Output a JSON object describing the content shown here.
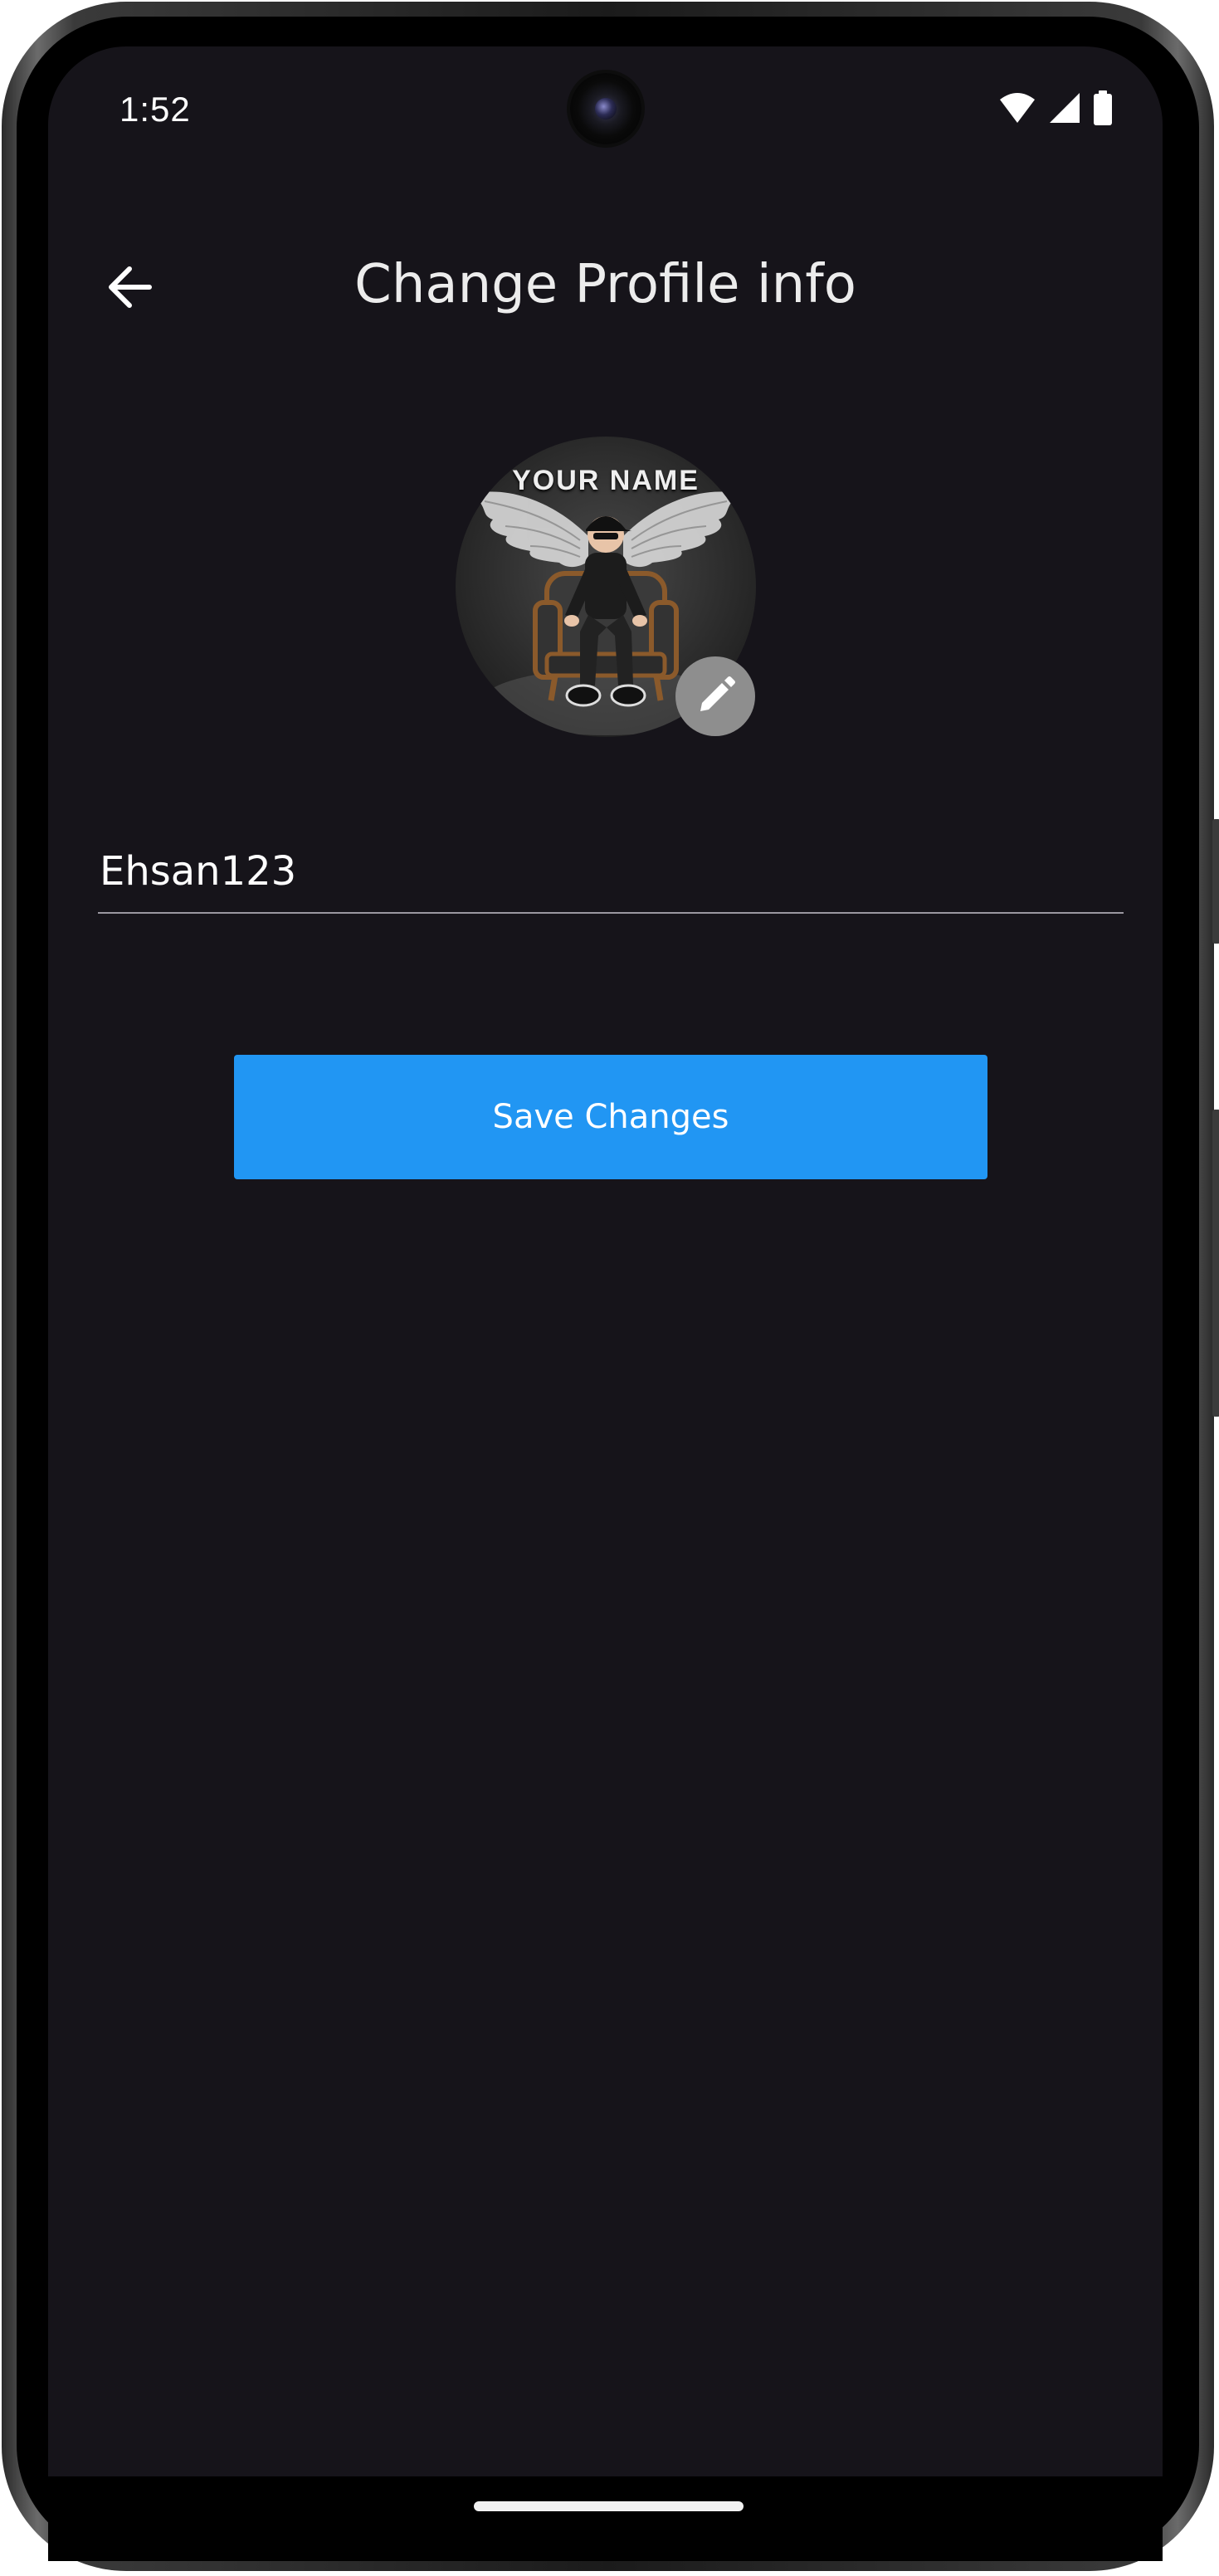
{
  "status_bar": {
    "time": "1:52",
    "icons": [
      "wifi-icon",
      "cellular-signal-icon",
      "battery-icon"
    ]
  },
  "app_bar": {
    "back_icon": "arrow-left-icon",
    "title": "Change Profile info"
  },
  "profile": {
    "avatar_caption": "YOUR NAME",
    "edit_icon": "pencil-icon",
    "name_value": "Ehsan123"
  },
  "actions": {
    "save_label": "Save Changes"
  },
  "colors": {
    "background": "#16141a",
    "accent": "#2196f3",
    "badge": "#8e8e8e",
    "text": "#ececec"
  }
}
